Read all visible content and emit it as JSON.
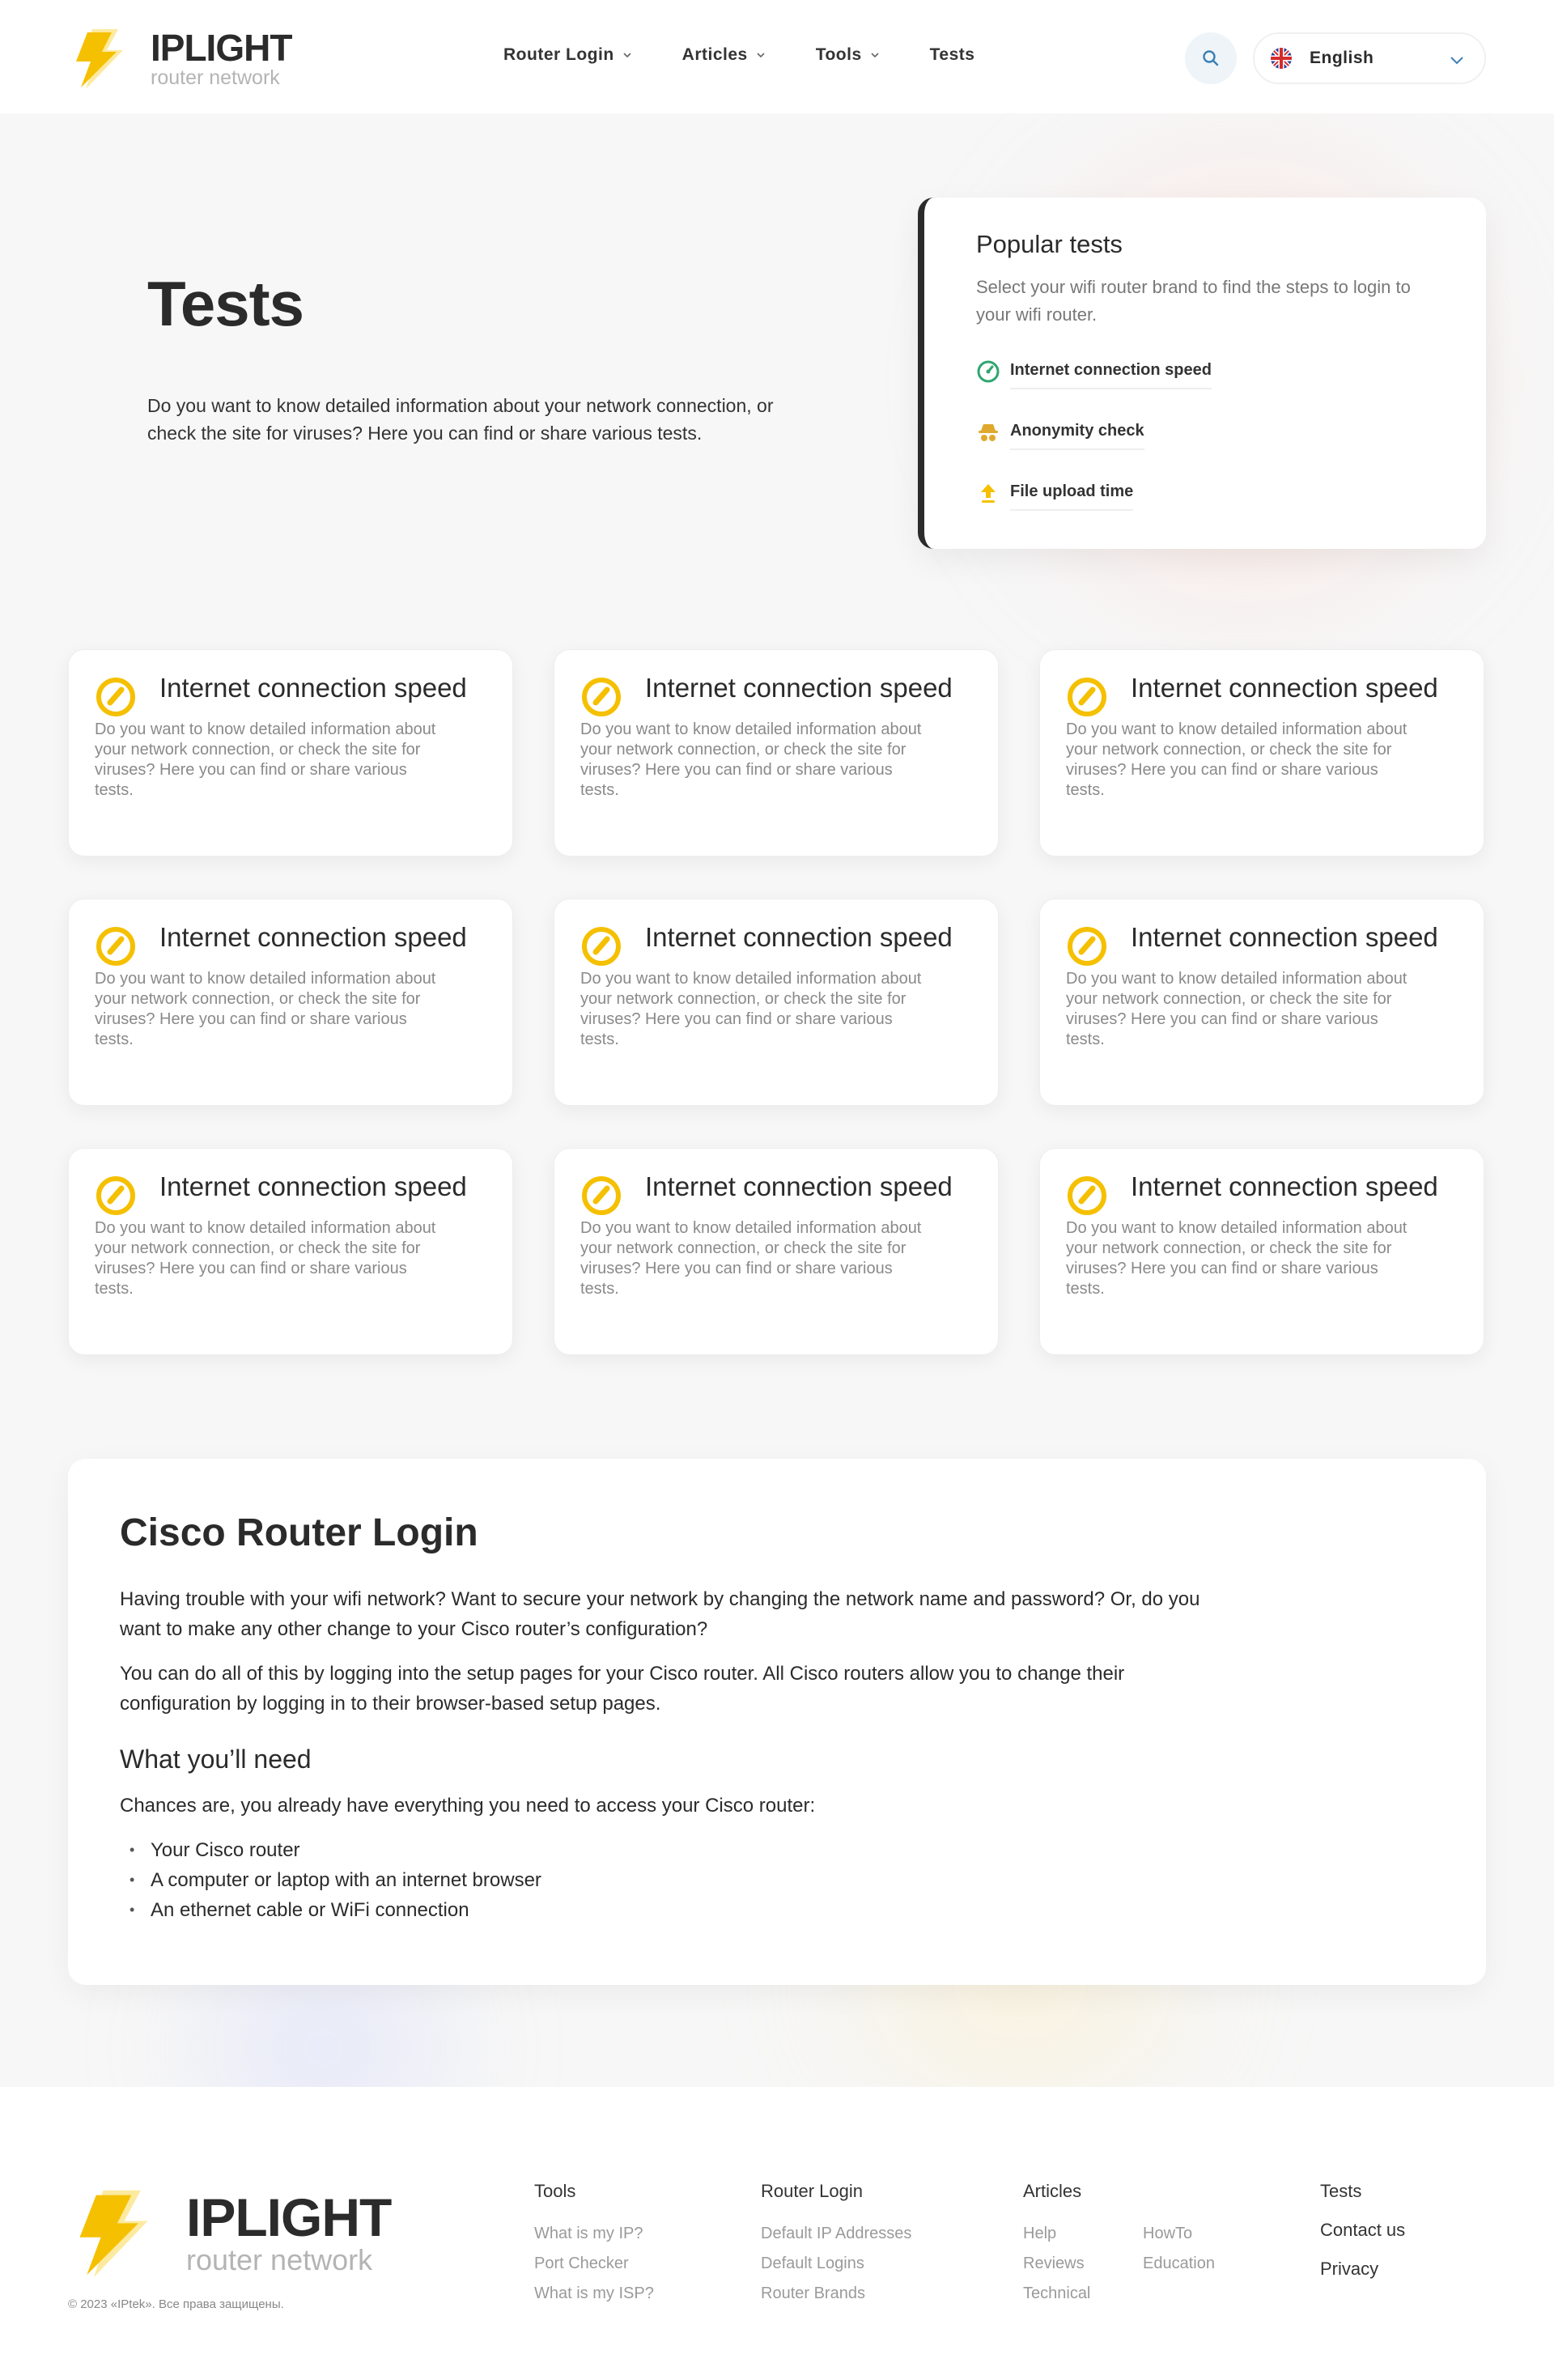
{
  "colors": {
    "accent": "#f5c000",
    "dark": "#2b2b2b",
    "muted": "#8a8a8a",
    "green": "#2ea66f"
  },
  "header": {
    "logo_name": "IPLIGHT",
    "logo_sub": "router network",
    "nav": [
      {
        "label": "Router Login",
        "has_dropdown": true
      },
      {
        "label": "Articles",
        "has_dropdown": true
      },
      {
        "label": "Tools",
        "has_dropdown": true
      },
      {
        "label": "Tests",
        "has_dropdown": false
      }
    ],
    "search_icon": "search-icon",
    "language": {
      "label": "English",
      "flag": "uk-flag-icon"
    }
  },
  "hero": {
    "title": "Tests",
    "description": "Do you want to know detailed information about your network connection, or check the site for viruses? Here you can find or share various tests."
  },
  "popular": {
    "title": "Popular tests",
    "subtitle": "Select your wifi router brand to find the steps to login to your wifi router.",
    "items": [
      {
        "label": "Internet connection speed",
        "icon": "speedometer-icon"
      },
      {
        "label": "Anonymity check",
        "icon": "spy-icon"
      },
      {
        "label": "File upload time",
        "icon": "upload-icon"
      }
    ]
  },
  "cards": [
    {
      "title": "Internet connection speed",
      "text": "Do you want to know detailed information about your network connection, or check the site for viruses? Here you can find or share various tests."
    },
    {
      "title": "Internet connection speed",
      "text": "Do you want to know detailed information about your network connection, or check the site for viruses? Here you can find or share various tests."
    },
    {
      "title": "Internet connection speed",
      "text": "Do you want to know detailed information about your network connection, or check the site for viruses? Here you can find or share various tests."
    },
    {
      "title": "Internet connection speed",
      "text": "Do you want to know detailed information about your network connection, or check the site for viruses? Here you can find or share various tests."
    },
    {
      "title": "Internet connection speed",
      "text": "Do you want to know detailed information about your network connection, or check the site for viruses? Here you can find or share various tests."
    },
    {
      "title": "Internet connection speed",
      "text": "Do you want to know detailed information about your network connection, or check the site for viruses? Here you can find or share various tests."
    },
    {
      "title": "Internet connection speed",
      "text": "Do you want to know detailed information about your network connection, or check the site for viruses? Here you can find or share various tests."
    },
    {
      "title": "Internet connection speed",
      "text": "Do you want to know detailed information about your network connection, or check the site for viruses? Here you can find or share various tests."
    },
    {
      "title": "Internet connection speed",
      "text": "Do you want to know detailed information about your network connection, or check the site for viruses? Here you can find or share various tests."
    }
  ],
  "article": {
    "title": "Cisco Router Login",
    "p1": "Having trouble with your wifi network? Want to secure your network by changing the network name and password? Or, do you want to make any other change to your Cisco router’s configuration?",
    "p2": "You can do all of this by logging into the setup pages for your Cisco router. All Cisco routers allow you to change their configuration by logging in to their browser-based setup pages.",
    "subtitle": "What you’ll need",
    "p3": "Chances are, you already have everything you need to access your Cisco router:",
    "list": [
      "Your Cisco router",
      "A computer or laptop with an internet browser",
      "An ethernet cable or WiFi connection"
    ]
  },
  "footer": {
    "logo_name": "IPLIGHT",
    "logo_sub": "router network",
    "copyright": "© 2023 «IPtek». Все права защищены.",
    "tools": {
      "title": "Tools",
      "links": [
        "What is my IP?",
        "Port Checker",
        "What is my ISP?"
      ]
    },
    "router_login": {
      "title": "Router Login",
      "links": [
        "Default IP Addresses",
        "Default Logins",
        "Router Brands"
      ]
    },
    "articles": {
      "title": "Articles",
      "links": [
        "Help",
        "HowTo",
        "Reviews",
        "Education",
        "Technical"
      ]
    },
    "links": [
      "Tests",
      "Contact us",
      "Privacy"
    ]
  }
}
